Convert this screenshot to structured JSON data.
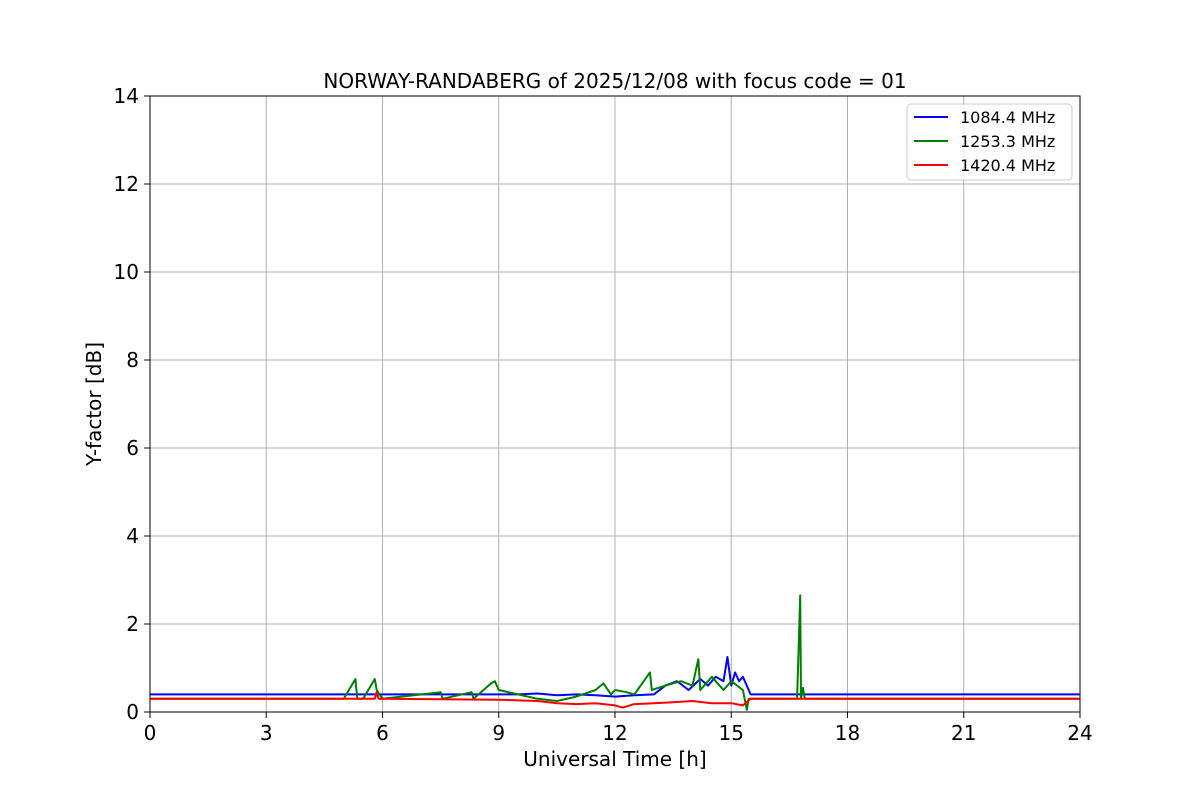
{
  "chart_data": {
    "type": "line",
    "title": "NORWAY-RANDABERG of 2025/12/08 with focus code = 01",
    "xlabel": "Universal Time [h]",
    "ylabel": "Y-factor [dB]",
    "xlim": [
      0,
      24
    ],
    "ylim": [
      0,
      14
    ],
    "xticks": [
      0,
      3,
      6,
      9,
      12,
      15,
      18,
      21,
      24
    ],
    "yticks": [
      0,
      2,
      4,
      6,
      8,
      10,
      12,
      14
    ],
    "grid": true,
    "legend_position": "top-right",
    "series": [
      {
        "name": "1084.4 MHz",
        "color": "#0000ff",
        "x": [
          0,
          1,
          2,
          3,
          4,
          5,
          6,
          7,
          8,
          9,
          9.5,
          10,
          10.5,
          11,
          11.5,
          12,
          12.5,
          13,
          13.3,
          13.6,
          13.9,
          14.2,
          14.4,
          14.6,
          14.8,
          14.9,
          15.0,
          15.1,
          15.2,
          15.3,
          15.4,
          15.5,
          16,
          17,
          18,
          19,
          20,
          21,
          22,
          23,
          24
        ],
        "values": [
          0.4,
          0.4,
          0.4,
          0.4,
          0.4,
          0.4,
          0.4,
          0.4,
          0.4,
          0.4,
          0.4,
          0.42,
          0.38,
          0.4,
          0.38,
          0.35,
          0.38,
          0.4,
          0.6,
          0.7,
          0.5,
          0.75,
          0.6,
          0.8,
          0.7,
          1.25,
          0.6,
          0.9,
          0.7,
          0.8,
          0.6,
          0.4,
          0.4,
          0.4,
          0.4,
          0.4,
          0.4,
          0.4,
          0.4,
          0.4,
          0.4
        ]
      },
      {
        "name": "1253.3 MHz",
        "color": "#008000",
        "x": [
          0,
          3,
          5.0,
          5.3,
          5.35,
          5.5,
          5.8,
          5.85,
          6.0,
          7.5,
          7.55,
          8.3,
          8.35,
          8.8,
          8.9,
          9.0,
          9.5,
          10,
          10.5,
          11,
          11.5,
          11.7,
          11.9,
          12.0,
          12.3,
          12.5,
          12.9,
          12.95,
          13.3,
          13.7,
          14.0,
          14.15,
          14.2,
          14.5,
          14.7,
          14.8,
          15.0,
          15.3,
          15.4,
          15.45,
          15.5,
          16,
          16.7,
          16.78,
          16.8,
          16.85,
          16.9,
          17,
          18,
          19,
          20,
          21,
          22,
          23,
          24
        ],
        "values": [
          0.3,
          0.3,
          0.3,
          0.75,
          0.3,
          0.3,
          0.75,
          0.5,
          0.3,
          0.45,
          0.3,
          0.45,
          0.3,
          0.65,
          0.7,
          0.5,
          0.4,
          0.3,
          0.25,
          0.35,
          0.5,
          0.65,
          0.4,
          0.5,
          0.45,
          0.4,
          0.9,
          0.5,
          0.6,
          0.7,
          0.6,
          1.2,
          0.5,
          0.8,
          0.6,
          0.5,
          0.7,
          0.5,
          0.05,
          0.3,
          0.3,
          0.3,
          0.3,
          2.65,
          0.3,
          0.55,
          0.3,
          0.3,
          0.3,
          0.3,
          0.3,
          0.3,
          0.3,
          0.3,
          0.3
        ]
      },
      {
        "name": "1420.4 MHz",
        "color": "#ff0000",
        "x": [
          0,
          3,
          5.8,
          5.85,
          5.9,
          6,
          9,
          10,
          10.5,
          11,
          11.5,
          12,
          12.2,
          12.5,
          13,
          13.5,
          14,
          14.5,
          15,
          15.3,
          15.5,
          16,
          18,
          21,
          24
        ],
        "values": [
          0.3,
          0.3,
          0.3,
          0.45,
          0.3,
          0.3,
          0.28,
          0.25,
          0.2,
          0.18,
          0.2,
          0.15,
          0.1,
          0.18,
          0.2,
          0.22,
          0.25,
          0.2,
          0.2,
          0.15,
          0.3,
          0.3,
          0.3,
          0.3,
          0.3
        ]
      }
    ]
  }
}
